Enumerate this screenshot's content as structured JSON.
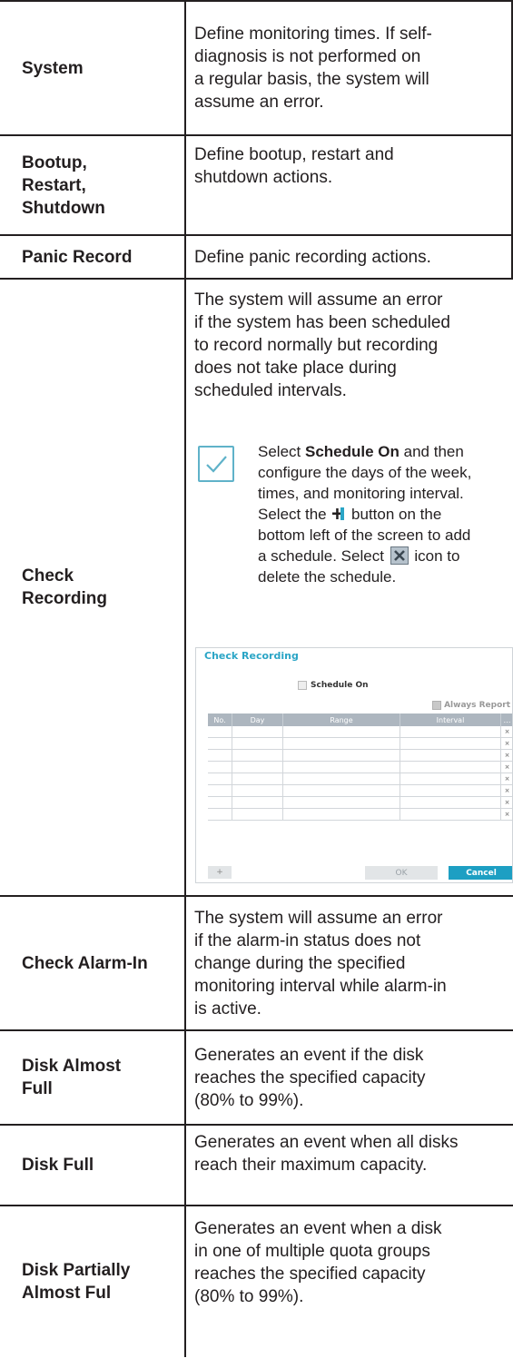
{
  "rows": [
    {
      "label": "System",
      "desc": "Define monitoring times. If self-\ndiagnosis is not performed on\na regular basis, the system will\nassume an error."
    },
    {
      "label": "Bootup,\nRestart,\nShutdown",
      "desc": "Define bootup, restart and\nshutdown actions."
    },
    {
      "label": "Panic Record",
      "desc": "Define panic recording actions."
    },
    {
      "label": "Check\nRecording",
      "desc": "The system will assume an error\nif the system has been scheduled\nto record normally but recording\ndoes not take place during\nscheduled intervals."
    },
    {
      "label": "Check Alarm-In",
      "desc": "The system will assume an error\nif the alarm-in status does not\nchange during the specified\nmonitoring interval while alarm-in\nis active."
    },
    {
      "label": "Disk Almost\nFull",
      "desc": "Generates an event if the disk\nreaches the specified capacity\n(80% to 99%)."
    },
    {
      "label": "Disk Full",
      "desc": "Generates an event when all disks\nreach their maximum capacity."
    },
    {
      "label": "Disk Partially\nAlmost Ful",
      "desc": "Generates an event when a disk\nin one of multiple quota groups\nreaches the specified capacity\n(80% to 99%)."
    }
  ],
  "note": {
    "icon": "checkmark-note-icon",
    "line1_pre": "Select ",
    "line1_bold": "Schedule On",
    "line1_post": " and then",
    "line2": "configure the days of the week,",
    "line3": "times, and monitoring interval.",
    "line4_pre": "Select the ",
    "line4_post": " button on the",
    "line5": "bottom left of the screen to add",
    "line6_pre": "a schedule. Select ",
    "line6_post": " icon to",
    "line7": "delete the schedule."
  },
  "dialog": {
    "title": "Check Recording",
    "schedule_on": "Schedule On",
    "always_report": "Always Report",
    "columns": [
      "No.",
      "Day",
      "Range",
      "Interval",
      "…"
    ],
    "row_count": 8,
    "add_label": "+",
    "ok_label": "OK",
    "cancel_label": "Cancel"
  },
  "colors": {
    "text": "#231f20",
    "accent": "#1d9fc3",
    "note_icon": "#5fb2c9"
  }
}
